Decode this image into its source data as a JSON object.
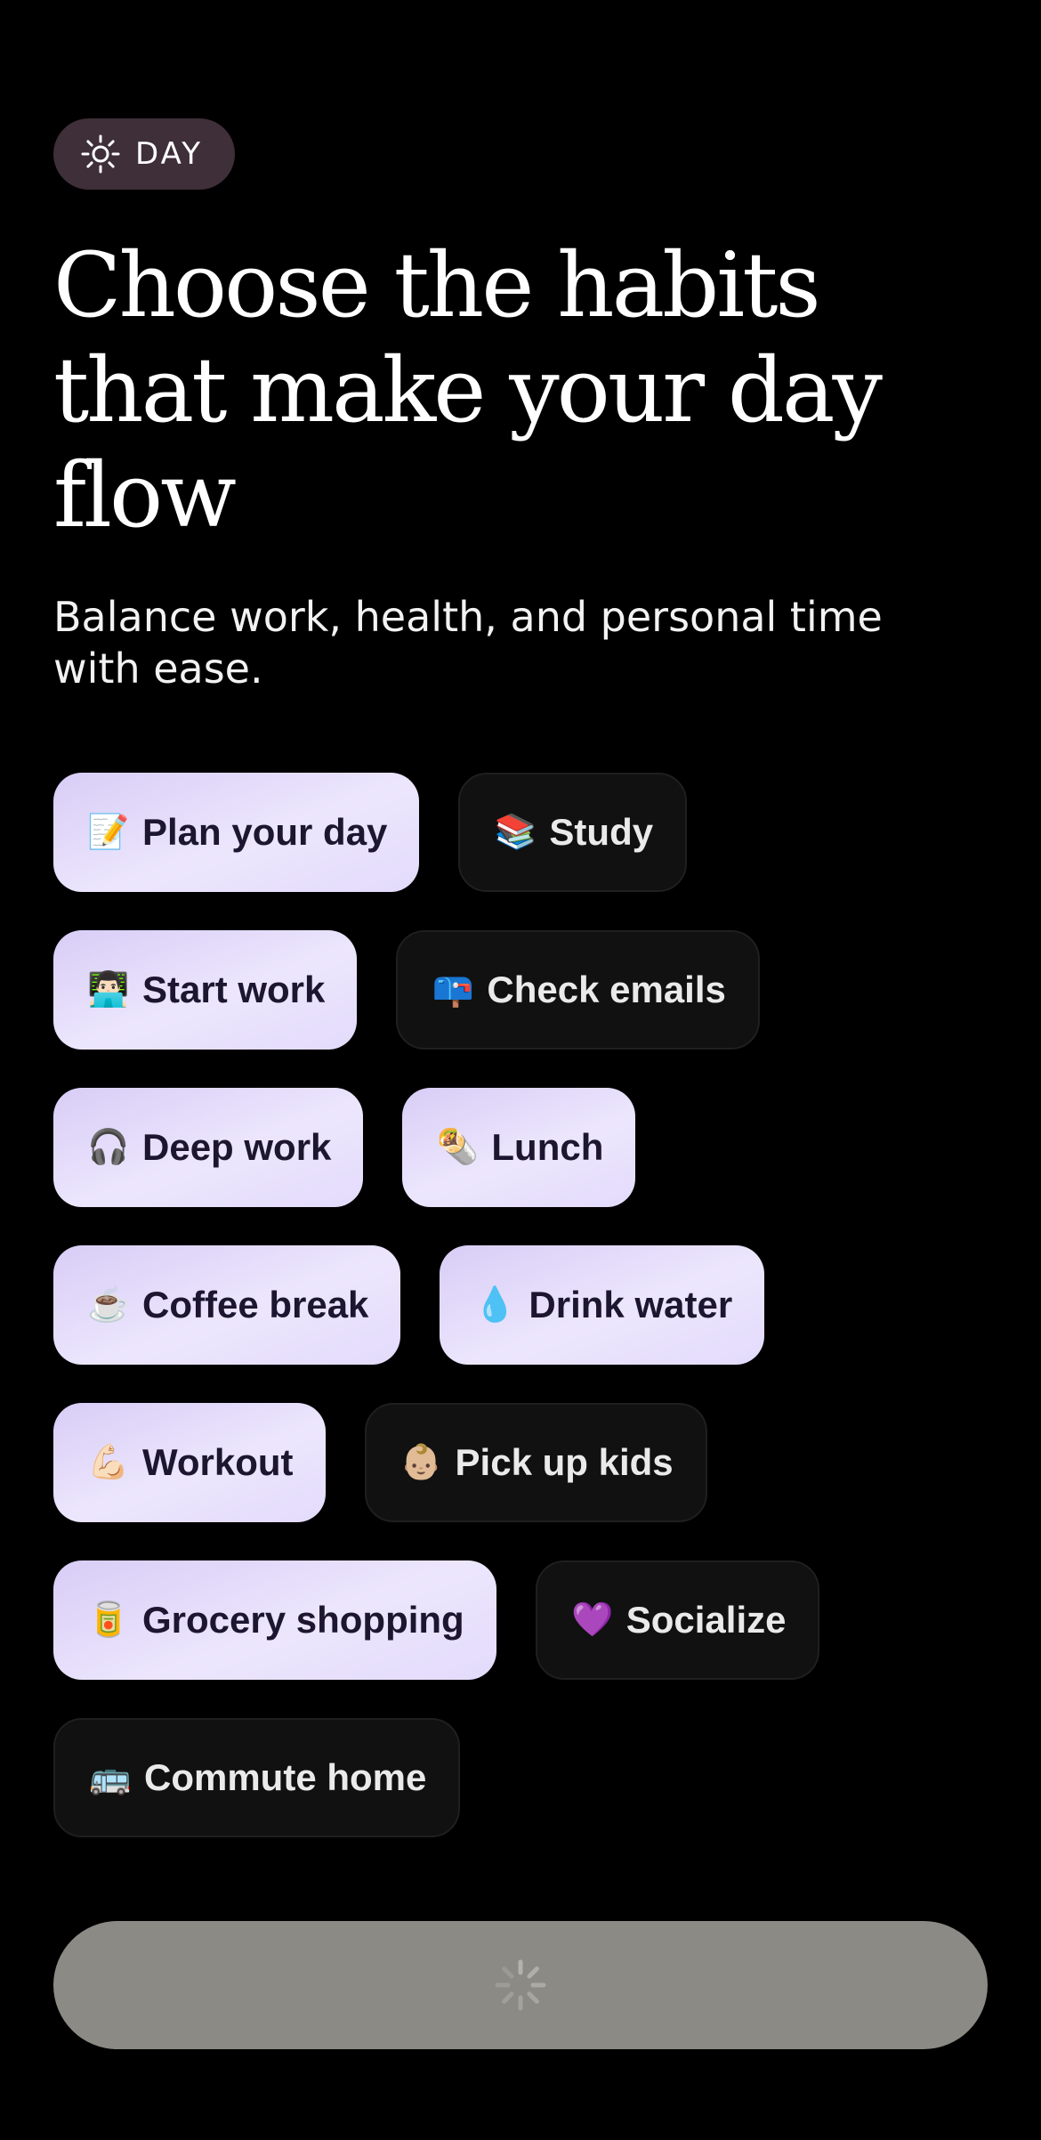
{
  "mode_badge": {
    "icon": "sun-icon",
    "label": "DAY"
  },
  "headline": "Choose the habits that make your day flow",
  "subtitle": "Balance work, health, and personal time with ease.",
  "habits": [
    {
      "emoji": "📝",
      "label": "Plan your day",
      "selected": true
    },
    {
      "emoji": "📚",
      "label": "Study",
      "selected": false
    },
    {
      "emoji": "👨🏻‍💻",
      "label": "Start work",
      "selected": true
    },
    {
      "emoji": "📪",
      "label": "Check emails",
      "selected": false
    },
    {
      "emoji": "🎧",
      "label": "Deep work",
      "selected": true
    },
    {
      "emoji": "🌯",
      "label": "Lunch",
      "selected": true
    },
    {
      "emoji": "☕",
      "label": "Coffee break",
      "selected": true
    },
    {
      "emoji": "💧",
      "label": "Drink water",
      "selected": true
    },
    {
      "emoji": "💪🏻",
      "label": "Workout",
      "selected": true
    },
    {
      "emoji": "👶🏼",
      "label": "Pick up kids",
      "selected": false
    },
    {
      "emoji": "🥫",
      "label": "Grocery shopping",
      "selected": true
    },
    {
      "emoji": "💜",
      "label": "Socialize",
      "selected": false
    },
    {
      "emoji": "🚌",
      "label": "Commute home",
      "selected": false
    }
  ],
  "continue_button": {
    "state": "loading",
    "icon": "spinner-icon"
  },
  "colors": {
    "background": "#000000",
    "badge_background": "#3f2f38",
    "chip_selected_background": "#e6dffb",
    "chip_selected_text": "#1c1630",
    "chip_unselected_background": "#111111",
    "chip_unselected_text": "#eaeaea",
    "button_background": "#8b8a85"
  }
}
